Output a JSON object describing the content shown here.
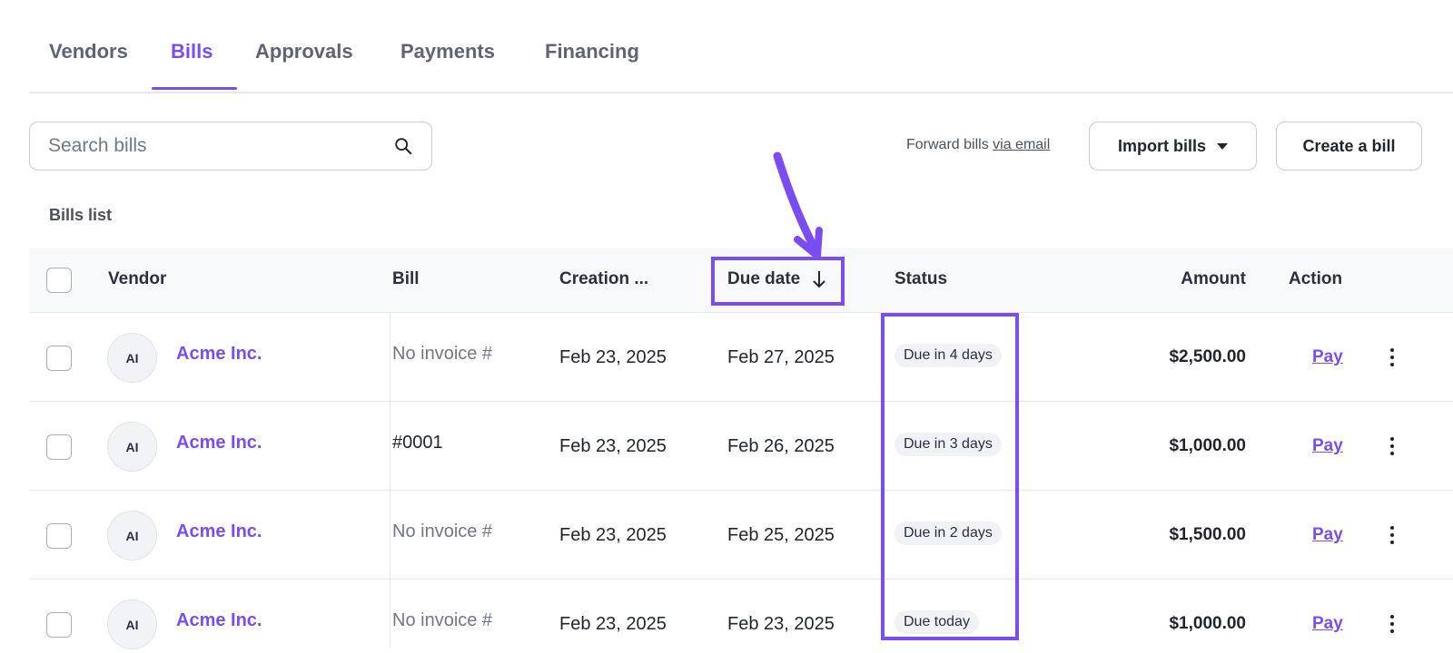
{
  "tabs": [
    {
      "label": "Vendors",
      "active": false
    },
    {
      "label": "Bills",
      "active": true
    },
    {
      "label": "Approvals",
      "active": false
    },
    {
      "label": "Payments",
      "active": false
    },
    {
      "label": "Financing",
      "active": false
    }
  ],
  "search": {
    "placeholder": "Search bills",
    "value": ""
  },
  "forward": {
    "text": "Forward bills",
    "link": "via email"
  },
  "buttons": {
    "import": "Import bills",
    "create": "Create a bill"
  },
  "section_title": "Bills list",
  "columns": {
    "vendor": "Vendor",
    "bill": "Bill",
    "creation": "Creation ...",
    "due": "Due date",
    "status": "Status",
    "amount": "Amount",
    "action": "Action"
  },
  "rows": [
    {
      "initials": "AI",
      "vendor": "Acme Inc.",
      "bill": "No invoice #",
      "bill_muted": true,
      "created": "Feb 23, 2025",
      "due": "Feb 27, 2025",
      "status": "Due in 4 days",
      "amount": "$2,500.00",
      "action": "Pay"
    },
    {
      "initials": "AI",
      "vendor": "Acme Inc.",
      "bill": "#0001",
      "bill_muted": false,
      "created": "Feb 23, 2025",
      "due": "Feb 26, 2025",
      "status": "Due in 3 days",
      "amount": "$1,000.00",
      "action": "Pay"
    },
    {
      "initials": "AI",
      "vendor": "Acme Inc.",
      "bill": "No invoice #",
      "bill_muted": true,
      "created": "Feb 23, 2025",
      "due": "Feb 25, 2025",
      "status": "Due in 2 days",
      "amount": "$1,500.00",
      "action": "Pay"
    },
    {
      "initials": "AI",
      "vendor": "Acme Inc.",
      "bill": "No invoice #",
      "bill_muted": true,
      "created": "Feb 23, 2025",
      "due": "Feb 23, 2025",
      "status": "Due today",
      "amount": "$1,000.00",
      "action": "Pay"
    }
  ],
  "colors": {
    "accent": "#7a4df0",
    "muted": "#70778a",
    "badge_bg": "#f0f2f6"
  }
}
